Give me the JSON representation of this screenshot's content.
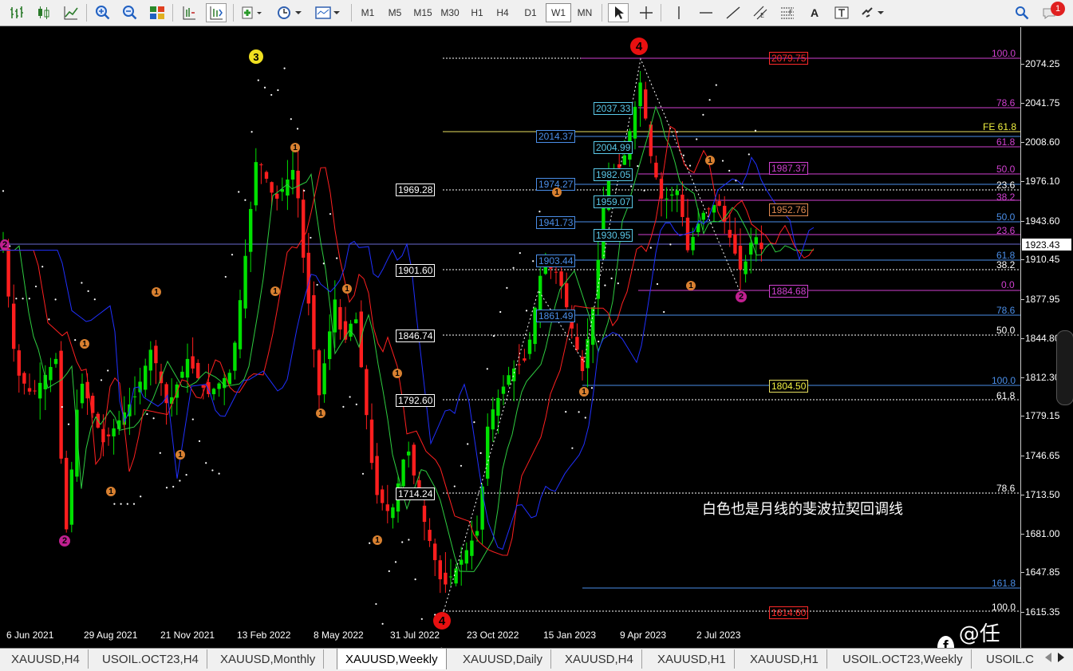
{
  "toolbar": {
    "timeframes": [
      "M1",
      "M5",
      "M15",
      "M30",
      "H1",
      "H4",
      "D1",
      "W1",
      "MN"
    ],
    "active_timeframe": "W1",
    "text_tool": "A",
    "notification_count": "1"
  },
  "axis": {
    "ticks": [
      "2074.25",
      "2041.75",
      "2008.60",
      "1976.10",
      "1943.60",
      "1910.45",
      "1877.95",
      "1844.80",
      "1812.30",
      "1779.15",
      "1746.65",
      "1713.50",
      "1681.00",
      "1647.85",
      "1615.35"
    ],
    "current_price": "1923.43"
  },
  "x_labels": [
    "6 Jun 2021",
    "29 Aug 2021",
    "21 Nov 2021",
    "13 Feb 2022",
    "8 May 2022",
    "31 Jul 2022",
    "23 Oct 2022",
    "15 Jan 2023",
    "9 Apr 2023",
    "2 Jul 2023"
  ],
  "levels": {
    "white": [
      "1969.28",
      "1901.60",
      "1846.74",
      "1792.60",
      "1714.24"
    ],
    "cyan": [
      "2037.33",
      "2004.99",
      "1982.05",
      "1959.07",
      "1930.95"
    ],
    "blue": [
      "2014.37",
      "1974.27",
      "1941.73",
      "1903.44",
      "1861.49"
    ],
    "red_top": "2079.75",
    "red_bottom": "1614.60",
    "magenta_1987": "1987.37",
    "magenta_1884": "1884.68",
    "orange_1952": "1952.76",
    "yellow_1804": "1804.50"
  },
  "fib_labels": {
    "magenta": [
      "100.0",
      "78.6",
      "61.8",
      "50.0",
      "38.2",
      "23.6",
      "0.0"
    ],
    "blue": [
      "50.0",
      "61.8",
      "78.6",
      "100.0",
      "161.8"
    ],
    "white": [
      "38.2",
      "23.6",
      "38.2",
      "50.0",
      "61.8",
      "78.6",
      "100.0"
    ],
    "fe": "FE 61.8"
  },
  "waves": {
    "top_3": "3",
    "top_4": "4",
    "bottom_4": "4",
    "purple_2_left": "2",
    "purple_2_bottom": "2",
    "purple_2_right": "2",
    "orange_1": "1"
  },
  "note": "白色也是月线的斐波拉契回调线",
  "watermark": "@任天成",
  "tabs": [
    "XAUUSD,H4",
    "USOIL.OCT23,H4",
    "XAUUSD,Monthly",
    "XAUUSD,Weekly",
    "XAUUSD,Daily",
    "XAUUSD,H4",
    "XAUUSD,H1",
    "XAUUSD,H1",
    "USOIL.OCT23,Weekly",
    "USOIL.C"
  ],
  "active_tab": "XAUUSD,Weekly",
  "colors": {
    "bull": "#00e000",
    "bear": "#ff1e1e",
    "ma_green": "#2ecc40",
    "ma_red": "#ff2020",
    "ma_blue": "#2030ff",
    "fib_magenta": "#d040d0",
    "fib_blue": "#4a8ee8"
  }
}
